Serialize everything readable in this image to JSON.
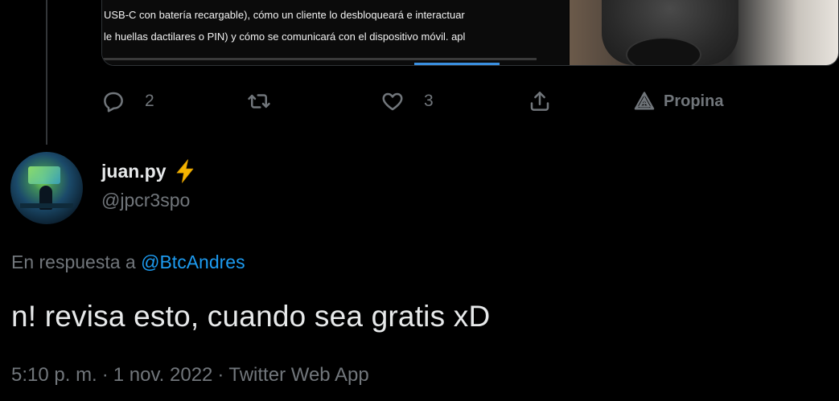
{
  "embed": {
    "line1": "USB-C con batería recargable), cómo un cliente lo desbloqueará e interactuar",
    "line2": "le huellas dactilares o PIN) y cómo se comunicará con el dispositivo móvil. apl"
  },
  "parent_actions": {
    "reply_count": "2",
    "retweet_count": "",
    "like_count": "3",
    "tip_label": "Propina"
  },
  "tweet": {
    "display_name": "juan.py",
    "handle": "@jpcr3spo",
    "reply_prefix": "En respuesta a ",
    "reply_target": "@BtcAndres",
    "text": "n! revisa esto, cuando sea gratis xD",
    "time": "5:10 p. m.",
    "separator": "·",
    "date": "1 nov. 2022",
    "source": "Twitter Web App"
  },
  "colors": {
    "background": "#000000",
    "text": "#e7e9ea",
    "muted": "#71767b",
    "link": "#1d9bf0",
    "bolt": "#f4b400"
  },
  "icons": {
    "reply": "reply-bubble-icon",
    "retweet": "retweet-arrows-icon",
    "like": "heart-outline-icon",
    "share": "share-upload-icon",
    "tip": "tip-triangle-icon",
    "badge": "lightning-bolt-icon"
  }
}
